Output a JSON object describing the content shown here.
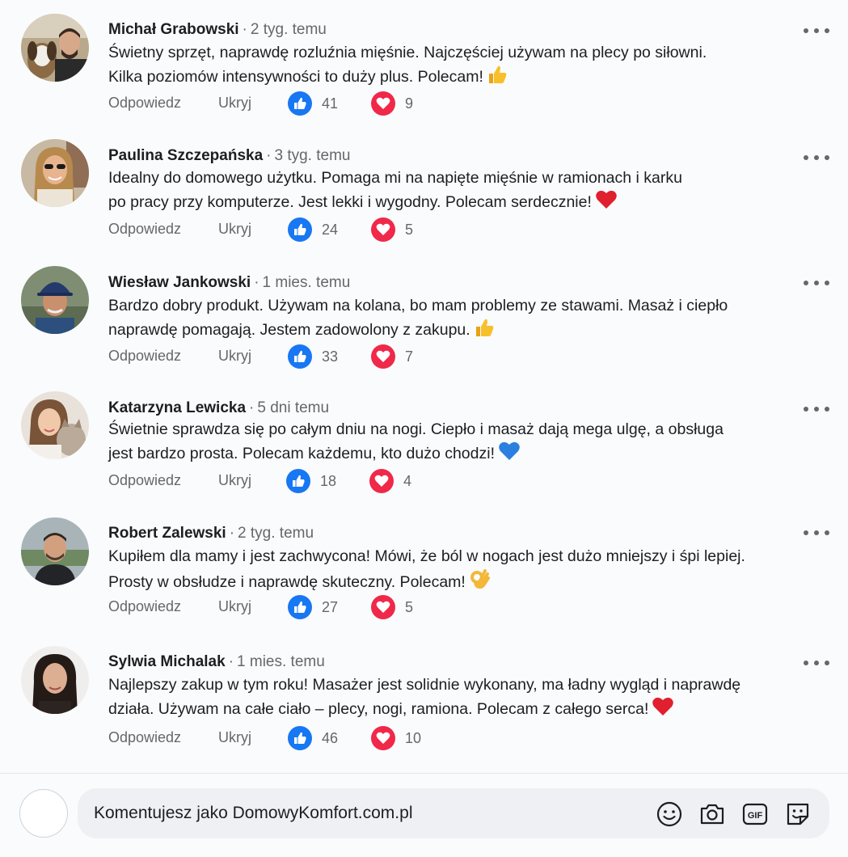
{
  "comments": [
    {
      "author": "Michał Grabowski",
      "time": "2 tyg. temu",
      "lines": [
        "Świetny sprzęt, naprawdę rozluźnia mięśnie. Najczęściej używam na plecy po siłowni.",
        "Kilka poziomów intensywności to duży plus. Polecam!"
      ],
      "emoji": "thumbs-up",
      "reply_label": "Odpowiedz",
      "hide_label": "Ukryj",
      "likes": "41",
      "hearts": "9"
    },
    {
      "author": "Paulina Szczepańska",
      "time": "3 tyg. temu",
      "lines": [
        "Idealny do domowego użytku. Pomaga mi na napięte mięśnie w ramionach i karku",
        "po pracy przy komputerze. Jest lekki i wygodny. Polecam serdecznie!"
      ],
      "emoji": "red-heart",
      "reply_label": "Odpowiedz",
      "hide_label": "Ukryj",
      "likes": "24",
      "hearts": "5"
    },
    {
      "author": "Wiesław Jankowski",
      "time": "1 mies. temu",
      "lines": [
        "Bardzo dobry produkt. Używam na kolana, bo mam problemy ze stawami. Masaż i ciepło",
        "naprawdę pomagają. Jestem zadowolony z zakupu."
      ],
      "emoji": "thumbs-up",
      "reply_label": "Odpowiedz",
      "hide_label": "Ukryj",
      "likes": "33",
      "hearts": "7"
    },
    {
      "author": "Katarzyna Lewicka",
      "time": "5 dni temu",
      "lines": [
        "Świetnie sprawdza się po całym dniu na nogi. Ciepło i masaż dają mega ulgę, a obsługa",
        "jest bardzo prosta. Polecam każdemu, kto dużo chodzi!"
      ],
      "emoji": "blue-heart",
      "reply_label": "Odpowiedz",
      "hide_label": "Ukryj",
      "likes": "18",
      "hearts": "4"
    },
    {
      "author": "Robert Zalewski",
      "time": "2 tyg. temu",
      "lines": [
        "Kupiłem dla mamy i jest zachwycona! Mówi, że ból w nogach jest dużo mniejszy i śpi lepiej.",
        "Prosty w obsłudze i naprawdę skuteczny. Polecam!"
      ],
      "emoji": "ok-hand",
      "reply_label": "Odpowiedz",
      "hide_label": "Ukryj",
      "likes": "27",
      "hearts": "5"
    },
    {
      "author": "Sylwia Michalak",
      "time": "1 mies. temu",
      "lines": [
        "Najlepszy zakup w tym roku! Masażer jest solidnie wykonany, ma ładny wygląd i naprawdę",
        "działa. Używam na całe ciało – plecy, nogi, ramiona. Polecam z całego serca!"
      ],
      "emoji": "red-heart",
      "reply_label": "Odpowiedz",
      "hide_label": "Ukryj",
      "likes": "46",
      "hearts": "10"
    }
  ],
  "separator": "·",
  "composer": {
    "placeholder": "Komentujesz jako DomowyKomfort.com.pl",
    "icons": [
      "emoji-icon",
      "camera-icon",
      "gif-icon",
      "sticker-icon"
    ],
    "gif_label": "GIF"
  },
  "colors": {
    "like": "#1877f2",
    "love": "#f02849",
    "muted": "#65676b"
  }
}
